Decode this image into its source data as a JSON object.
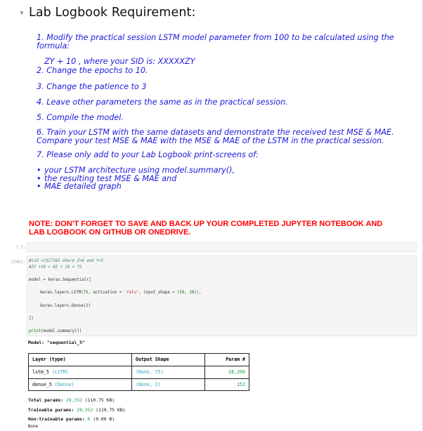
{
  "markdown": {
    "heading": "Lab Logbook Requirement:",
    "items": [
      {
        "number": "1.",
        "text": "Modify the practical session LSTM model parameter from 100 to be calculated using the formula:",
        "sub": "ZY + 10 , where your SID is: XXXXXZY"
      },
      {
        "number": "2.",
        "text": "Change the epochs to 10."
      },
      {
        "number": "3.",
        "text": "Change the patience to 3"
      },
      {
        "number": "4.",
        "text": "Leave other parameters the same as in the practical session."
      },
      {
        "number": "5.",
        "text": "Compile the model."
      },
      {
        "number": "6.",
        "text": "Train your LSTM with the same datasets and demonstrate the received test MSE & MAE. Compare your test MSE & MAE with the MSE & MAE of the LSTM in the practical session."
      },
      {
        "number": "7.",
        "text": "Please only add to your Lab Logbook print-screens of:"
      }
    ],
    "bullets": [
      "your LSTM architecture using model.summary(),",
      "the resulting test MSE & MAE and",
      "MAE detailed graph"
    ],
    "note": "NOTE: DON'T FORGET TO SAVE AND BACK UP YOUR COMPLETED JUPYTER NOTEBOOK AND LAB LOGBOOK ON GITHUB OR ONEDRIVE."
  },
  "cells": {
    "empty_prompt": "[ ]:",
    "code_prompt": "[245]:",
    "code": {
      "comment1": "#sid =2327265 where Z=6 and Y=5",
      "comment2": "#ZY +10 = 65 + 10 = 75",
      "line_model": "model = keras.Sequential([",
      "line_lstm_pre": "keras.layers.LSTM(",
      "line_lstm_num": "75",
      "line_lstm_mid": ", activation = ",
      "line_lstm_str": "'relu'",
      "line_lstm_mid2": ", input_shape = (",
      "line_lstm_n1": "50",
      "line_lstm_comma": ", ",
      "line_lstm_n2": "18",
      "line_lstm_end": ")),",
      "line_dense_pre": "keras.layers.Dense(",
      "line_dense_num": "2",
      "line_dense_end": ")",
      "line_close": "])",
      "line_print_fn": "print",
      "line_print_rest": "(model.summary())"
    }
  },
  "output": {
    "model_title": "Model: \"sequential_5\"",
    "table": {
      "headers": [
        "Layer (type)",
        "Output Shape",
        "Param #"
      ],
      "rows": [
        {
          "layer": "lstm_5 ",
          "type": "(LSTM)",
          "shape": "(None, 75)",
          "params": "28,200"
        },
        {
          "layer": "dense_5 ",
          "type": "(Dense)",
          "shape": "(None, 2)",
          "params": "152"
        }
      ]
    },
    "total_label": "Total params: ",
    "total_value": "28,352",
    "total_size": " (110.75 KB)",
    "trainable_label": "Trainable params: ",
    "trainable_value": "28,352",
    "trainable_size": " (110.75 KB)",
    "nontrainable_label": "Non-trainable params: ",
    "nontrainable_value": "0",
    "nontrainable_size": " (0.00 B)",
    "none_text": "None"
  },
  "colors": {
    "instruction_blue": "#1a1adb",
    "note_red": "#ff0000",
    "teal": "#2aa1b3",
    "param_green": "#18a34a"
  }
}
